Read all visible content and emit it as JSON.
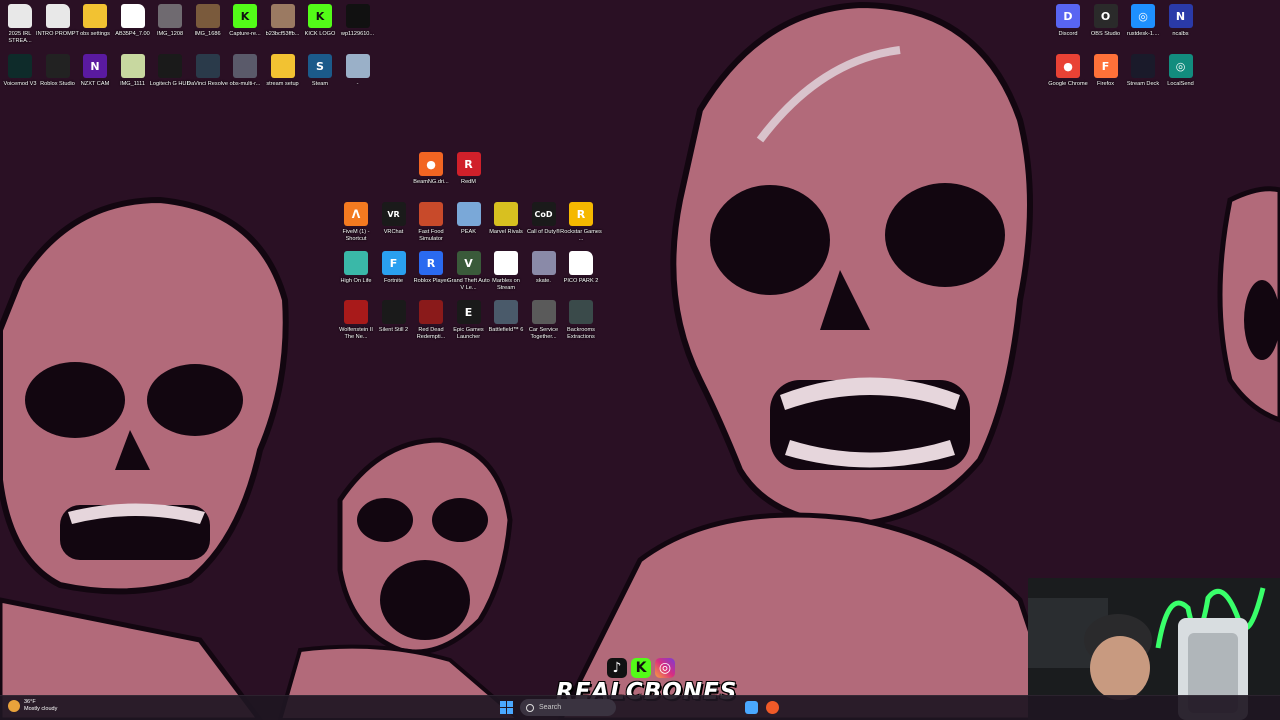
{
  "desktop_icons": {
    "top_left_row1": [
      {
        "label": "2025 IRL STREA...",
        "icon": "document-icon",
        "color": "#e8e8e8"
      },
      {
        "label": "INTRO PROMPT",
        "icon": "document-icon",
        "color": "#e8e8e8"
      },
      {
        "label": "obs settings",
        "icon": "folder-icon",
        "color": "#f2c232"
      },
      {
        "label": "AB35P4_7.00",
        "icon": "document-icon",
        "color": "#ffffff"
      },
      {
        "label": "IMG_1208",
        "icon": "photo-icon",
        "color": "#6f6a70"
      },
      {
        "label": "IMG_1686",
        "icon": "photo-icon",
        "color": "#7a5a3c"
      },
      {
        "label": "Capture-re...",
        "icon": "kick-icon",
        "color": "#53fc18"
      },
      {
        "label": "b23bcf53ffb...",
        "icon": "photo-icon",
        "color": "#9b7a62"
      },
      {
        "label": "KICK LOGO",
        "icon": "kick-icon",
        "color": "#53fc18"
      },
      {
        "label": "wp1129610...",
        "icon": "photo-icon",
        "color": "#111111"
      }
    ],
    "top_left_row2": [
      {
        "label": "Voicemod V3",
        "icon": "voicemod-icon",
        "color": "#0e2b2a"
      },
      {
        "label": "Roblox Studio",
        "icon": "roblox-studio-icon",
        "color": "#222222"
      },
      {
        "label": "NZXT CAM",
        "icon": "nzxt-icon",
        "color": "#5a1aa0"
      },
      {
        "label": "IMG_1111",
        "icon": "photo-icon",
        "color": "#c8d8a0"
      },
      {
        "label": "Logitech G HUB",
        "icon": "logitech-icon",
        "color": "#1a1a1a"
      },
      {
        "label": "DaVinci Resolve",
        "icon": "davinci-icon",
        "color": "#2a3a4a"
      },
      {
        "label": "obs-multi-r...",
        "icon": "obs-multi-icon",
        "color": "#5a5a6a"
      },
      {
        "label": "stream setup",
        "icon": "folder-icon",
        "color": "#f2c232"
      },
      {
        "label": "Steam",
        "icon": "steam-icon",
        "color": "#1b5a8a"
      },
      {
        "label": "-",
        "icon": "recycle-bin-icon",
        "color": "#9ab0c8"
      }
    ],
    "top_right_row1": [
      {
        "label": "Discord",
        "icon": "discord-icon",
        "color": "#5865f2"
      },
      {
        "label": "OBS Studio",
        "icon": "obs-icon",
        "color": "#2a2a2a"
      },
      {
        "label": "rustdesk-1....",
        "icon": "rustdesk-icon",
        "color": "#1e90ff"
      },
      {
        "label": "ncalbs",
        "icon": "ncalbs-icon",
        "color": "#2a3aa8"
      }
    ],
    "top_right_row2": [
      {
        "label": "Google Chrome",
        "icon": "chrome-icon",
        "color": "#e94235"
      },
      {
        "label": "Firefox",
        "icon": "firefox-icon",
        "color": "#ff7139"
      },
      {
        "label": "Stream Deck",
        "icon": "stream-deck-icon",
        "color": "#1a1a2a"
      },
      {
        "label": "LocalSend",
        "icon": "localsend-icon",
        "color": "#128c7e"
      }
    ],
    "center_row0": [
      {
        "label": "BeamNG.dri...",
        "icon": "beamng-icon",
        "color": "#f26522"
      },
      {
        "label": "RedM",
        "icon": "redm-icon",
        "color": "#d0202a"
      }
    ],
    "center_row1": [
      {
        "label": "FiveM (1) - Shortcut",
        "icon": "fivem-icon",
        "color": "#f47a20"
      },
      {
        "label": "VRChat",
        "icon": "vrchat-icon",
        "color": "#1a1a1a"
      },
      {
        "label": "Fast Food Simulator",
        "icon": "game-icon",
        "color": "#c84a2a"
      },
      {
        "label": "PEAK",
        "icon": "game-icon",
        "color": "#7aa8d8"
      },
      {
        "label": "Marvel Rivals",
        "icon": "game-icon",
        "color": "#d8c020"
      },
      {
        "label": "Call of Duty®",
        "icon": "cod-icon",
        "color": "#1a1a1a"
      },
      {
        "label": "Rockstar Games ...",
        "icon": "rockstar-icon",
        "color": "#f5b800"
      }
    ],
    "center_row2": [
      {
        "label": "High On Life",
        "icon": "game-icon",
        "color": "#3ab8a8"
      },
      {
        "label": "Fortnite",
        "icon": "fortnite-icon",
        "color": "#2aa0f0"
      },
      {
        "label": "Roblox Player",
        "icon": "roblox-icon",
        "color": "#2a6af0"
      },
      {
        "label": "Grand Theft Auto V Le...",
        "icon": "gta-icon",
        "color": "#3a5a3a"
      },
      {
        "label": "Marbles on Stream",
        "icon": "game-icon",
        "color": "#ffffff"
      },
      {
        "label": "skate.",
        "icon": "game-icon",
        "color": "#8a8aa8"
      },
      {
        "label": "PICO PARK 2",
        "icon": "document-icon",
        "color": "#ffffff"
      }
    ],
    "center_row3": [
      {
        "label": "Wolfenstein II The Ne...",
        "icon": "game-icon",
        "color": "#a81a1a"
      },
      {
        "label": "Silent Still 2",
        "icon": "game-icon",
        "color": "#1a1a1a"
      },
      {
        "label": "Red Dead Redempti...",
        "icon": "game-icon",
        "color": "#8a1a1a"
      },
      {
        "label": "Epic Games Launcher",
        "icon": "epic-icon",
        "color": "#1a1a1a"
      },
      {
        "label": "Battlefield™ 6",
        "icon": "game-icon",
        "color": "#4a5a6a"
      },
      {
        "label": "Car Service Together...",
        "icon": "game-icon",
        "color": "#5a5a5a"
      },
      {
        "label": "Backrooms Extractions",
        "icon": "game-icon",
        "color": "#3a4a4a"
      }
    ]
  },
  "taskbar": {
    "weather": {
      "temp": "36°F",
      "condition": "Mostly cloudy"
    },
    "search_label": "Search"
  },
  "overlay": {
    "streamer_name": "REALCBONES",
    "tiktok_glyph": "♪",
    "kick_glyph": "K",
    "instagram_glyph": "◎"
  },
  "colors": {
    "wallpaper_bg": "#2a1024",
    "skull": "#b26a7a",
    "skull_shadow": "#7a3a4e",
    "skull_highlight": "#d9c3cc"
  }
}
